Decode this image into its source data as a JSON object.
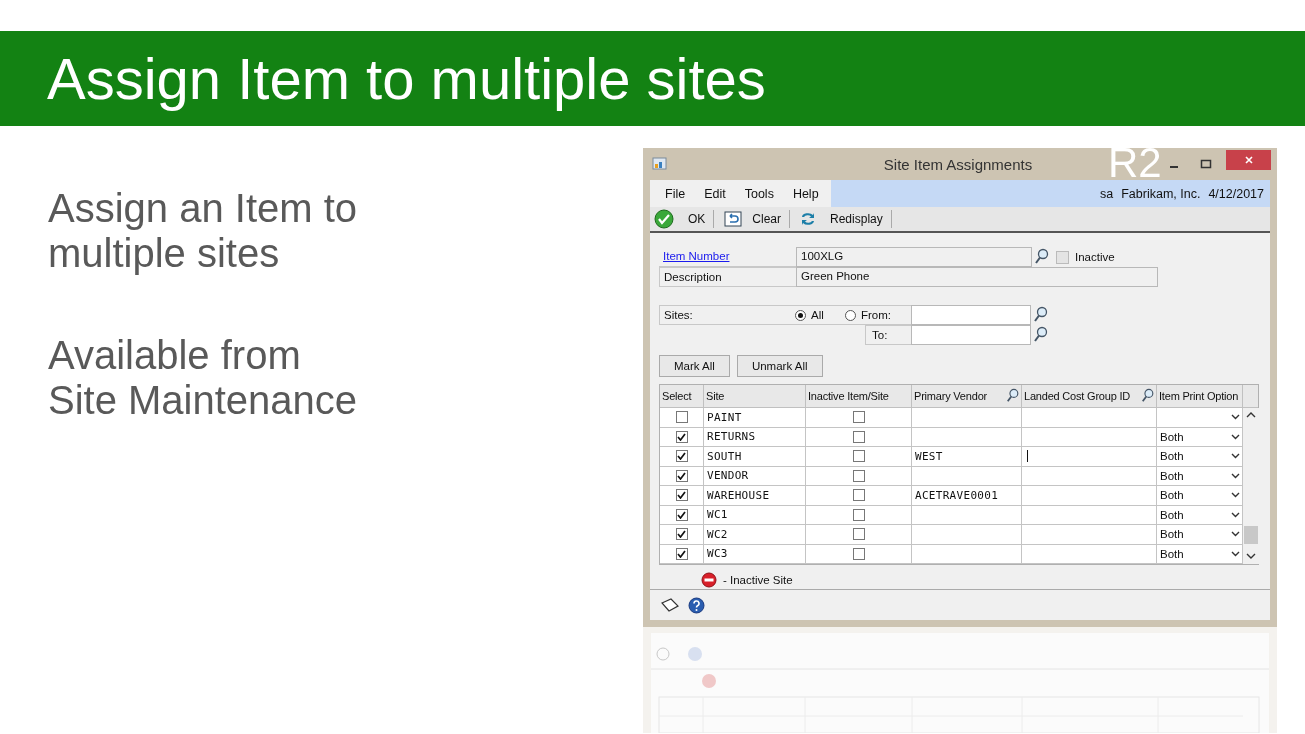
{
  "slide": {
    "title": "Assign Item to multiple sites",
    "bullets": [
      "Assign an Item to multiple sites",
      "Available from Site Maintenance"
    ]
  },
  "window": {
    "title": "Site Item Assignments",
    "overlay_text": "R2"
  },
  "menu": [
    "File",
    "Edit",
    "Tools",
    "Help"
  ],
  "session": {
    "user": "sa",
    "company": "Fabrikam, Inc.",
    "date": "4/12/2017"
  },
  "toolbar": [
    {
      "kind": "ok",
      "label": "OK"
    },
    {
      "kind": "clear",
      "label": "Clear"
    },
    {
      "kind": "redisplay",
      "label": "Redisplay"
    }
  ],
  "item_number": {
    "label": "Item Number",
    "value": "100XLG"
  },
  "inactive": {
    "label": "Inactive",
    "checked": false
  },
  "description": {
    "label": "Description",
    "value": "Green Phone"
  },
  "sites": {
    "label": "Sites:",
    "options": [
      {
        "label": "All",
        "selected": true
      },
      {
        "label": "From:",
        "selected": false
      }
    ],
    "to_label": "To:"
  },
  "buttons": [
    "Mark All",
    "Unmark All"
  ],
  "table": {
    "columns": [
      "Select",
      "Site",
      "Inactive Item/Site",
      "Primary Vendor",
      "Landed Cost Group ID",
      "Item Print Option"
    ],
    "rows": [
      {
        "selected": false,
        "site": "PAINT",
        "inactive": false,
        "caret": false
      },
      {
        "selected": true,
        "site": "RETURNS",
        "inactive": false,
        "caret": false,
        "print_option": "Both"
      },
      {
        "selected": true,
        "site": "SOUTH",
        "inactive": false,
        "primary_vendor": "WEST",
        "caret": true,
        "print_option": "Both"
      },
      {
        "selected": true,
        "site": "VENDOR",
        "inactive": false,
        "caret": false,
        "print_option": "Both"
      },
      {
        "selected": true,
        "site": "WAREHOUSE",
        "inactive": false,
        "primary_vendor": "ACETRAVE0001",
        "caret": false,
        "print_option": "Both"
      },
      {
        "selected": true,
        "site": "WC1",
        "inactive": false,
        "caret": false,
        "print_option": "Both"
      },
      {
        "selected": true,
        "site": "WC2",
        "inactive": false,
        "caret": false,
        "print_option": "Both"
      },
      {
        "selected": true,
        "site": "WC3",
        "inactive": false,
        "caret": false,
        "print_option": "Both"
      }
    ]
  },
  "legend": "- Inactive Site"
}
